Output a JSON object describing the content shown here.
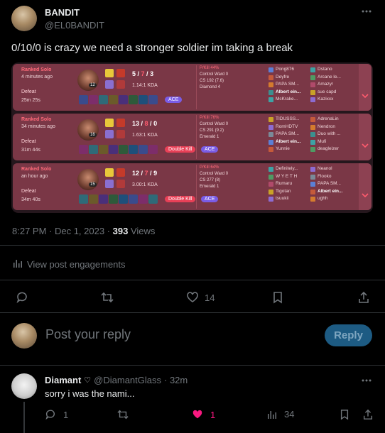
{
  "post": {
    "author_name": "BANDIT",
    "author_handle": "@EL0BANDIT",
    "text": "0/10/0 is crazy we need a stronger soldier im taking a break",
    "time": "8:27 PM · Dec 1, 2023 ·",
    "views_count": "393",
    "views_label": "Views",
    "engagements_label": "View post engagements",
    "like_count": "14"
  },
  "games": [
    {
      "queue": "Ranked Solo",
      "ago": "4 minutes ago",
      "result": "Defeat",
      "duration": "25m 25s",
      "level": "12",
      "kills": "5",
      "deaths": "7",
      "assists": "3",
      "kda": "1.14:1 KDA",
      "badges": [
        "ACE"
      ],
      "pkill": "P/Kill 44%",
      "ward": "Control Ward 0",
      "cs": "CS 192 (7.6)",
      "rank": "Diamond 4",
      "team1": [
        "Pong876",
        "Deyfre",
        "PAPA SM...",
        "Albert ein...",
        "McKrake..."
      ],
      "team2": [
        "Dstano",
        "Arcane le...",
        "Amazyr",
        "sue capd",
        "Kazixxx"
      ]
    },
    {
      "queue": "Ranked Solo",
      "ago": "34 minutes ago",
      "result": "Defeat",
      "duration": "31m 44s",
      "level": "16",
      "kills": "13",
      "deaths": "8",
      "assists": "0",
      "kda": "1.63:1 KDA",
      "badges": [
        "Double Kill",
        "ACE"
      ],
      "pkill": "P/Kill 76%",
      "ward": "Control Ward 0",
      "cs": "CS 291 (9.2)",
      "rank": "Emerald 1",
      "team1": [
        "TIDUSSS...",
        "RomHDTV",
        "PAPA SM...",
        "Albert ein...",
        "Yunnie"
      ],
      "team2": [
        "AdrenaLin",
        "Nendron",
        "Duo with ...",
        "Mufi",
        "deagleizer"
      ]
    },
    {
      "queue": "Ranked Solo",
      "ago": "an hour ago",
      "result": "Defeat",
      "duration": "34m 40s",
      "level": "15",
      "kills": "12",
      "deaths": "7",
      "assists": "9",
      "kda": "3.00:1 KDA",
      "badges": [
        "Double Kill",
        "ACE"
      ],
      "pkill": "P/Kill 64%",
      "ward": "Control Ward 0",
      "cs": "CS 277 (8)",
      "rank": "Emerald 1",
      "team1": [
        "Definitely...",
        "W Y E T H",
        "Rumaru",
        "Tigotan",
        "tsuukii"
      ],
      "team2": [
        "Neanol",
        "Flooko",
        "PAPA SM...",
        "Albert ein...",
        "ughh"
      ]
    }
  ],
  "compose": {
    "placeholder": "Post your reply",
    "button": "Reply"
  },
  "reply": {
    "name": "Diamant",
    "handle": "@DiamantGlass",
    "time": "· 32m",
    "text": "sorry i was the nami...",
    "comments": "1",
    "likes": "1",
    "views": "34"
  },
  "colors": {
    "like_active": "#f91880",
    "accent": "#1d9bf0"
  }
}
